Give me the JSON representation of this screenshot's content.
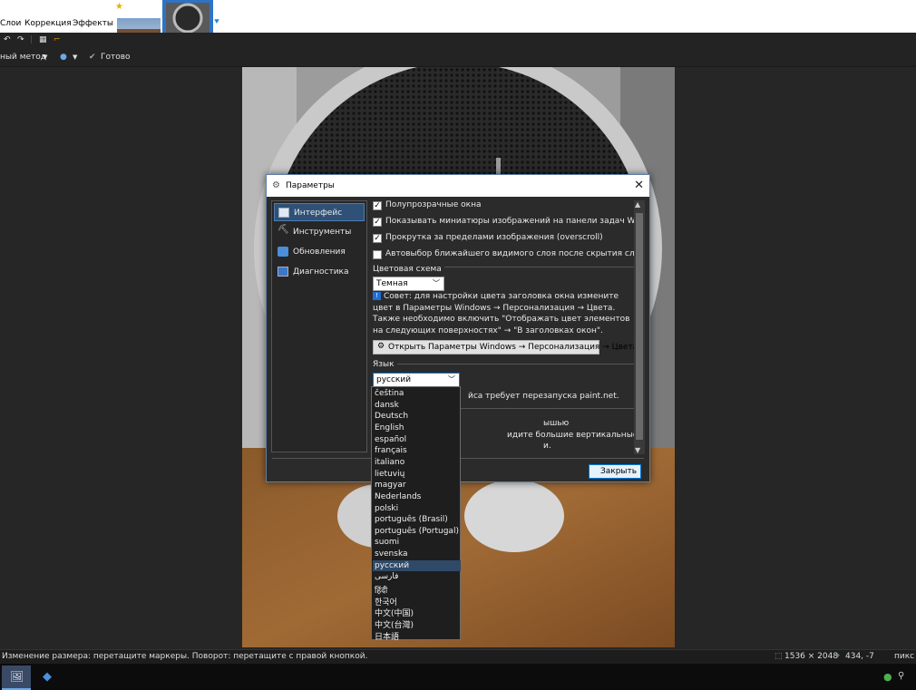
{
  "menu": [
    "Слои",
    "Коррекция",
    "Эффекты"
  ],
  "toolbar2": {
    "method_label": "ный метод",
    "done_label": "Готово"
  },
  "status": {
    "hint": "Изменение размера: перетащите маркеры. Поворот: перетащите с правой кнопкой.",
    "size": "1536 × 2048",
    "position": "434, -7",
    "unit": "пикс"
  },
  "dialog": {
    "title": "Параметры",
    "nav": [
      "Интерфейс",
      "Инструменты",
      "Обновления",
      "Диагностика"
    ],
    "checkboxes": [
      {
        "label": "Полупрозрачные окна",
        "checked": true
      },
      {
        "label": "Показывать миниатюры изображений на панели задач Windows",
        "checked": true
      },
      {
        "label": "Прокрутка за пределами изображения (overscroll)",
        "checked": true
      },
      {
        "label": "Автовыбор ближайшего видимого слоя после скрытия слоя",
        "checked": false
      }
    ],
    "color_scheme_label": "Цветовая схема",
    "color_scheme_value": "Темная",
    "tip": "Совет: для настройки цвета заголовка окна измените цвет в Параметры Windows → Персонализация → Цвета. Также необходимо включить \"Отображать цвет элементов на следующих поверхностях\" → \"В заголовках окон\".",
    "open_settings_button": "Открыть Параметры Windows → Персонализация → Цвета",
    "language_label": "Язык",
    "language_value": "русский",
    "language_restart": "йса требует перезапуска paint.net.",
    "partial1": "ышью",
    "partial2": "идите большие вертикальные и горизонталь",
    "partial3": "и.",
    "close_button": "Закрыть"
  },
  "languages": [
    "čeština",
    "dansk",
    "Deutsch",
    "English",
    "español",
    "français",
    "italiano",
    "lietuvių",
    "magyar",
    "Nederlands",
    "polski",
    "português (Brasil)",
    "português (Portugal)",
    "suomi",
    "svenska",
    "русский",
    "فارسی",
    "हिंदी",
    "한국어",
    "中文(中国)",
    "中文(台灣)",
    "日本語"
  ],
  "selected_language_index": 15,
  "colors": {
    "accent": "#2f5177",
    "selection": "#2f4a68"
  }
}
